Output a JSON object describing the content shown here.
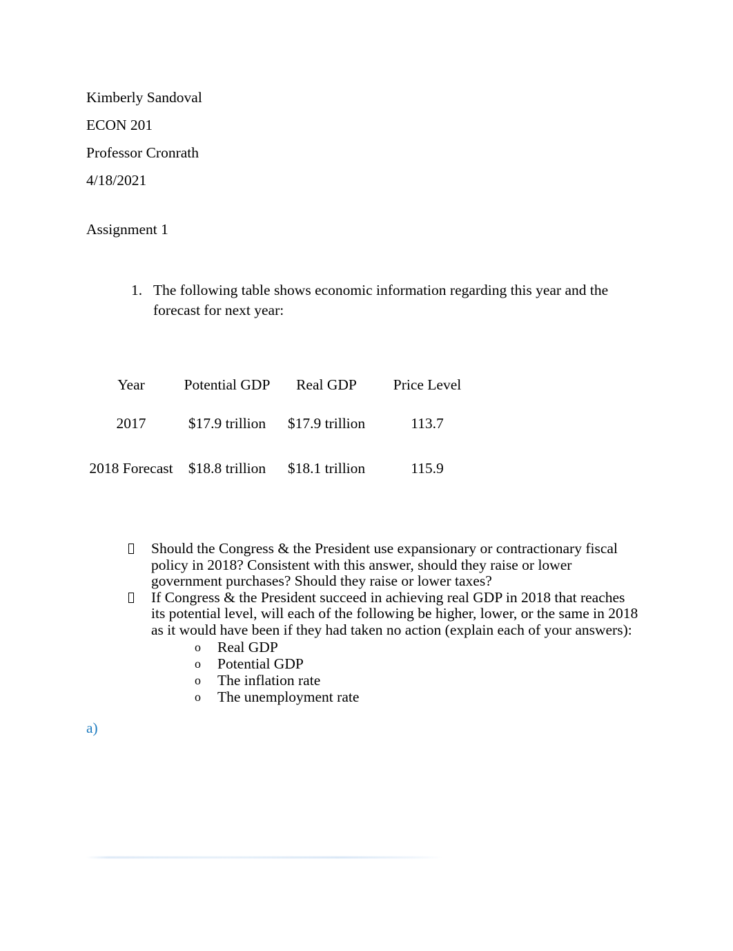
{
  "document": {
    "header_lines": [
      "Kimberly Sandoval",
      "ECON 201",
      "Professor Cronrath",
      "4/18/2021"
    ],
    "assignment_title": "Assignment 1",
    "question": {
      "marker": "1.",
      "text": "The following table shows economic information regarding this year and the forecast for next year:"
    },
    "table": {
      "columns": [
        "Year",
        "Potential GDP",
        "Real GDP",
        "Price Level"
      ],
      "rows": [
        [
          "2017",
          "$17.9 trillion",
          "$17.9 trillion",
          "113.7"
        ],
        [
          "2018 Forecast",
          "$18.8 trillion",
          "$18.1 trillion",
          "115.9"
        ]
      ]
    },
    "bullets": [
      {
        "marker_icon": "tofu-box-bullet-icon",
        "text": "Should the Congress & the President use expansionary or contractionary fiscal policy in 2018? Consistent with this answer, should they raise or lower government purchases? Should they raise or lower taxes?"
      },
      {
        "marker_icon": "tofu-box-bullet-icon",
        "text": "If Congress & the President succeed in achieving real GDP in 2018 that reaches its potential level, will each of the following be higher, lower, or the same in 2018 as it would have been if they had taken no action (explain each of your answers):"
      }
    ],
    "sub_items": [
      {
        "marker": "o",
        "text": "Real GDP"
      },
      {
        "marker": "o",
        "text": "Potential GDP"
      },
      {
        "marker": "o",
        "text": "The inflation rate"
      },
      {
        "marker": "o",
        "text": "The unemployment rate"
      }
    ],
    "answer_label": "a)",
    "colors": {
      "page_background": "#ffffff",
      "body_text": "#000000",
      "answer_label_blue": "#1f7cc0",
      "bottom_rule_blue": "#dbe8f6"
    }
  }
}
